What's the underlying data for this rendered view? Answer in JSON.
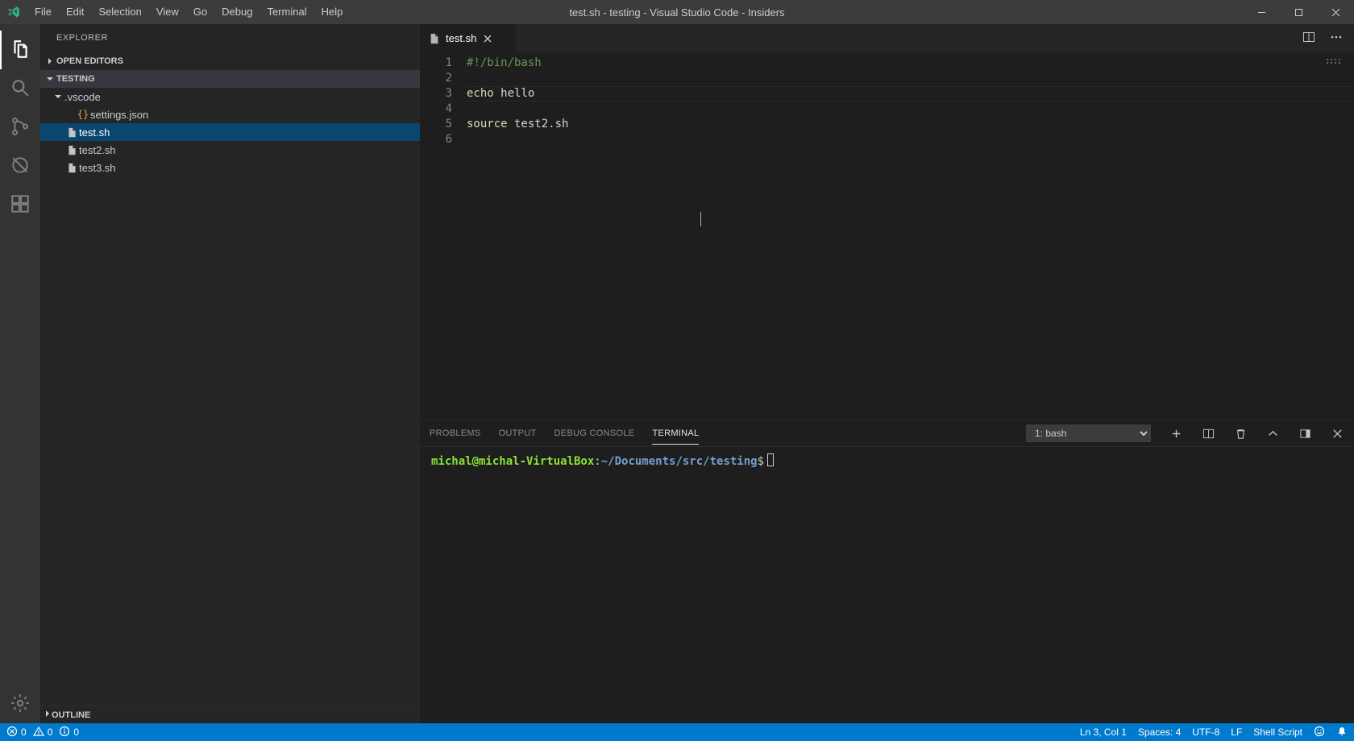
{
  "window": {
    "title": "test.sh - testing - Visual Studio Code - Insiders"
  },
  "menu": {
    "items": [
      "File",
      "Edit",
      "Selection",
      "View",
      "Go",
      "Debug",
      "Terminal",
      "Help"
    ]
  },
  "activitybar": {
    "items": [
      {
        "name": "explorer",
        "icon": "files-icon",
        "active": true
      },
      {
        "name": "search",
        "icon": "search-icon",
        "active": false
      },
      {
        "name": "source-control",
        "icon": "git-icon",
        "active": false
      },
      {
        "name": "debug",
        "icon": "debug-icon",
        "active": false
      },
      {
        "name": "extensions",
        "icon": "extensions-icon",
        "active": false
      }
    ],
    "bottom": [
      {
        "name": "settings",
        "icon": "gear-icon"
      }
    ]
  },
  "sidebar": {
    "title": "EXPLORER",
    "sections": {
      "open_editors_label": "OPEN EDITORS",
      "project_label": "TESTING",
      "outline_label": "OUTLINE"
    },
    "tree": [
      {
        "type": "folder",
        "label": ".vscode",
        "indent": 1,
        "expanded": true,
        "icon": "chevron"
      },
      {
        "type": "file",
        "label": "settings.json",
        "indent": 2,
        "icon": "json"
      },
      {
        "type": "file",
        "label": "test.sh",
        "indent": 1,
        "icon": "file",
        "selected": true
      },
      {
        "type": "file",
        "label": "test2.sh",
        "indent": 1,
        "icon": "file"
      },
      {
        "type": "file",
        "label": "test3.sh",
        "indent": 1,
        "icon": "file"
      }
    ]
  },
  "editor": {
    "active_tab": {
      "label": "test.sh",
      "icon": "file-icon"
    },
    "lines": [
      {
        "n": 1,
        "tokens": [
          {
            "cls": "tok-comment",
            "t": "#!/bin/bash"
          }
        ]
      },
      {
        "n": 2,
        "tokens": []
      },
      {
        "n": 3,
        "tokens": [
          {
            "cls": "tok-builtin",
            "t": "echo"
          },
          {
            "cls": "tok-plain",
            "t": " hello"
          }
        ],
        "current": true
      },
      {
        "n": 4,
        "tokens": []
      },
      {
        "n": 5,
        "tokens": [
          {
            "cls": "tok-builtin",
            "t": "source"
          },
          {
            "cls": "tok-plain",
            "t": " test2.sh"
          }
        ]
      },
      {
        "n": 6,
        "tokens": []
      }
    ]
  },
  "panel": {
    "tabs": {
      "problems": "PROBLEMS",
      "output": "OUTPUT",
      "debug_console": "DEBUG CONSOLE",
      "terminal": "TERMINAL"
    },
    "terminal_select": "1: bash",
    "terminal": {
      "user_host": "michal@michal-VirtualBox",
      "sep": ":",
      "path": "~/Documents/src/testing",
      "prompt_suffix": "$"
    }
  },
  "statusbar": {
    "errors": "0",
    "warnings": "0",
    "info": "0",
    "cursor": "Ln 3, Col 1",
    "spaces": "Spaces: 4",
    "encoding": "UTF-8",
    "eol": "LF",
    "language": "Shell Script"
  }
}
